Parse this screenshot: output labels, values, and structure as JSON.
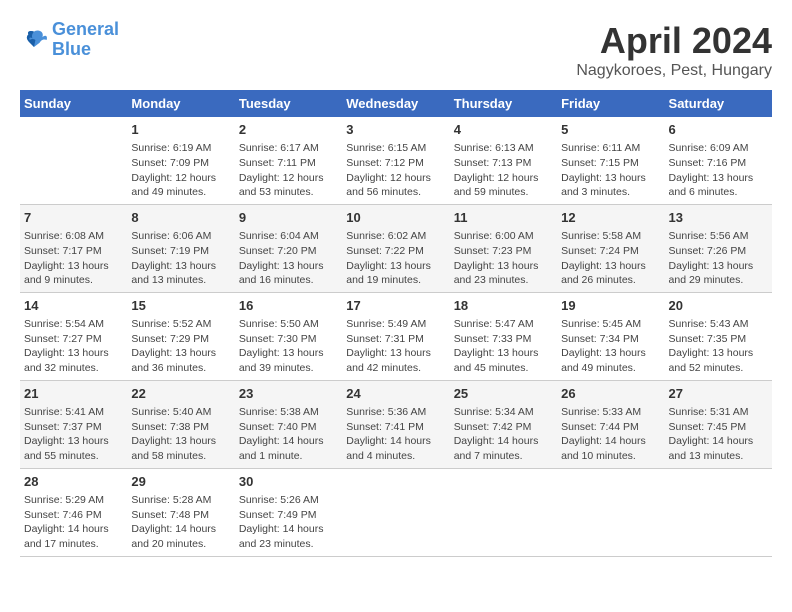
{
  "header": {
    "logo_line1": "General",
    "logo_line2": "Blue",
    "month": "April 2024",
    "location": "Nagykoroes, Pest, Hungary"
  },
  "weekdays": [
    "Sunday",
    "Monday",
    "Tuesday",
    "Wednesday",
    "Thursday",
    "Friday",
    "Saturday"
  ],
  "weeks": [
    [
      {
        "day": "",
        "content": ""
      },
      {
        "day": "1",
        "content": "Sunrise: 6:19 AM\nSunset: 7:09 PM\nDaylight: 12 hours\nand 49 minutes."
      },
      {
        "day": "2",
        "content": "Sunrise: 6:17 AM\nSunset: 7:11 PM\nDaylight: 12 hours\nand 53 minutes."
      },
      {
        "day": "3",
        "content": "Sunrise: 6:15 AM\nSunset: 7:12 PM\nDaylight: 12 hours\nand 56 minutes."
      },
      {
        "day": "4",
        "content": "Sunrise: 6:13 AM\nSunset: 7:13 PM\nDaylight: 12 hours\nand 59 minutes."
      },
      {
        "day": "5",
        "content": "Sunrise: 6:11 AM\nSunset: 7:15 PM\nDaylight: 13 hours\nand 3 minutes."
      },
      {
        "day": "6",
        "content": "Sunrise: 6:09 AM\nSunset: 7:16 PM\nDaylight: 13 hours\nand 6 minutes."
      }
    ],
    [
      {
        "day": "7",
        "content": "Sunrise: 6:08 AM\nSunset: 7:17 PM\nDaylight: 13 hours\nand 9 minutes."
      },
      {
        "day": "8",
        "content": "Sunrise: 6:06 AM\nSunset: 7:19 PM\nDaylight: 13 hours\nand 13 minutes."
      },
      {
        "day": "9",
        "content": "Sunrise: 6:04 AM\nSunset: 7:20 PM\nDaylight: 13 hours\nand 16 minutes."
      },
      {
        "day": "10",
        "content": "Sunrise: 6:02 AM\nSunset: 7:22 PM\nDaylight: 13 hours\nand 19 minutes."
      },
      {
        "day": "11",
        "content": "Sunrise: 6:00 AM\nSunset: 7:23 PM\nDaylight: 13 hours\nand 23 minutes."
      },
      {
        "day": "12",
        "content": "Sunrise: 5:58 AM\nSunset: 7:24 PM\nDaylight: 13 hours\nand 26 minutes."
      },
      {
        "day": "13",
        "content": "Sunrise: 5:56 AM\nSunset: 7:26 PM\nDaylight: 13 hours\nand 29 minutes."
      }
    ],
    [
      {
        "day": "14",
        "content": "Sunrise: 5:54 AM\nSunset: 7:27 PM\nDaylight: 13 hours\nand 32 minutes."
      },
      {
        "day": "15",
        "content": "Sunrise: 5:52 AM\nSunset: 7:29 PM\nDaylight: 13 hours\nand 36 minutes."
      },
      {
        "day": "16",
        "content": "Sunrise: 5:50 AM\nSunset: 7:30 PM\nDaylight: 13 hours\nand 39 minutes."
      },
      {
        "day": "17",
        "content": "Sunrise: 5:49 AM\nSunset: 7:31 PM\nDaylight: 13 hours\nand 42 minutes."
      },
      {
        "day": "18",
        "content": "Sunrise: 5:47 AM\nSunset: 7:33 PM\nDaylight: 13 hours\nand 45 minutes."
      },
      {
        "day": "19",
        "content": "Sunrise: 5:45 AM\nSunset: 7:34 PM\nDaylight: 13 hours\nand 49 minutes."
      },
      {
        "day": "20",
        "content": "Sunrise: 5:43 AM\nSunset: 7:35 PM\nDaylight: 13 hours\nand 52 minutes."
      }
    ],
    [
      {
        "day": "21",
        "content": "Sunrise: 5:41 AM\nSunset: 7:37 PM\nDaylight: 13 hours\nand 55 minutes."
      },
      {
        "day": "22",
        "content": "Sunrise: 5:40 AM\nSunset: 7:38 PM\nDaylight: 13 hours\nand 58 minutes."
      },
      {
        "day": "23",
        "content": "Sunrise: 5:38 AM\nSunset: 7:40 PM\nDaylight: 14 hours\nand 1 minute."
      },
      {
        "day": "24",
        "content": "Sunrise: 5:36 AM\nSunset: 7:41 PM\nDaylight: 14 hours\nand 4 minutes."
      },
      {
        "day": "25",
        "content": "Sunrise: 5:34 AM\nSunset: 7:42 PM\nDaylight: 14 hours\nand 7 minutes."
      },
      {
        "day": "26",
        "content": "Sunrise: 5:33 AM\nSunset: 7:44 PM\nDaylight: 14 hours\nand 10 minutes."
      },
      {
        "day": "27",
        "content": "Sunrise: 5:31 AM\nSunset: 7:45 PM\nDaylight: 14 hours\nand 13 minutes."
      }
    ],
    [
      {
        "day": "28",
        "content": "Sunrise: 5:29 AM\nSunset: 7:46 PM\nDaylight: 14 hours\nand 17 minutes."
      },
      {
        "day": "29",
        "content": "Sunrise: 5:28 AM\nSunset: 7:48 PM\nDaylight: 14 hours\nand 20 minutes."
      },
      {
        "day": "30",
        "content": "Sunrise: 5:26 AM\nSunset: 7:49 PM\nDaylight: 14 hours\nand 23 minutes."
      },
      {
        "day": "",
        "content": ""
      },
      {
        "day": "",
        "content": ""
      },
      {
        "day": "",
        "content": ""
      },
      {
        "day": "",
        "content": ""
      }
    ]
  ]
}
